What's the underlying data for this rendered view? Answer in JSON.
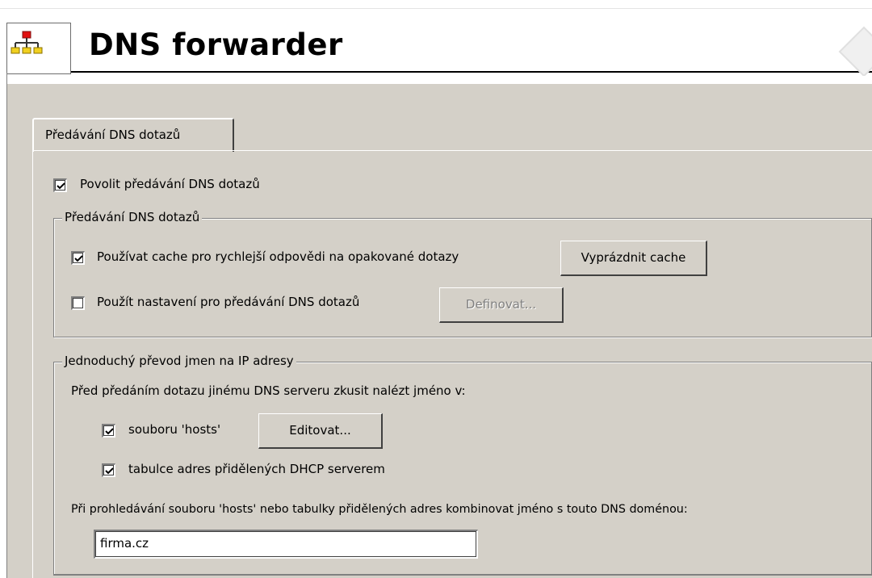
{
  "window": {
    "title": "DNS forwarder",
    "app_icon": "network-hierarchy-icon"
  },
  "tabs": [
    {
      "label": "Předávání DNS dotazů",
      "active": true
    }
  ],
  "enable_forwarding": {
    "label": "Povolit předávání DNS dotazů",
    "checked": true
  },
  "forwarding_group": {
    "title": "Předávání DNS dotazů",
    "use_cache": {
      "label": "Používat cache pro rychlejší odpovědi na opakované dotazy",
      "checked": true
    },
    "clear_cache_label": "Vyprázdnit cache",
    "use_settings": {
      "label": "Použít nastavení pro předávání DNS dotazů",
      "checked": false
    },
    "define_label": "Definovat..."
  },
  "simple_resolution_group": {
    "title": "Jednoduchý převod jmen na IP adresy",
    "intro": "Před předáním dotazu jinému DNS serveru zkusit nalézt jméno v:",
    "hosts_file": {
      "label": "souboru 'hosts'",
      "checked": true
    },
    "edit_label": "Editovat...",
    "dhcp_table": {
      "label": "tabulce adres přidělených DHCP serverem",
      "checked": true
    },
    "domain_prompt": "Při prohledávání souboru 'hosts' nebo tabulky přidělených adres kombinovat jméno s touto DNS doménou:",
    "domain_value": "firma.cz"
  }
}
